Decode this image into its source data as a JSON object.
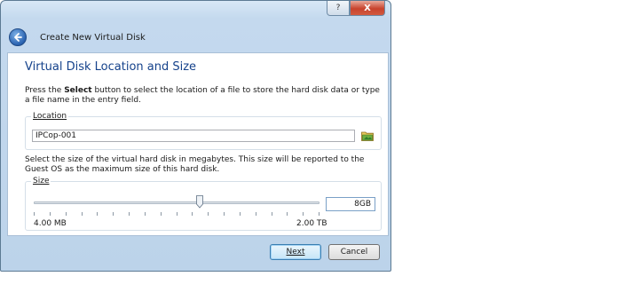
{
  "window": {
    "title": "Create New Virtual Disk",
    "caption_buttons": {
      "help": "?",
      "close": "X"
    }
  },
  "page": {
    "heading": "Virtual Disk Location and Size",
    "description_prefix": "Press the ",
    "description_bold": "Select",
    "description_suffix": " button to select the location of a file to store the hard disk data or type a file name in the entry field."
  },
  "location": {
    "label": "Location",
    "value": "IPCop-001",
    "browse_icon": "folder-icon"
  },
  "size": {
    "description": "Select the size of the virtual hard disk in megabytes. This size will be reported to the Guest OS as the maximum size of this hard disk.",
    "label": "Size",
    "value": "8GB",
    "slider_fraction": 0.58,
    "min_label": "4.00 MB",
    "max_label": "2.00 TB",
    "tick_count": 19
  },
  "buttons": {
    "next": "Next",
    "cancel": "Cancel"
  },
  "icons": {
    "back": "back-arrow-icon"
  }
}
